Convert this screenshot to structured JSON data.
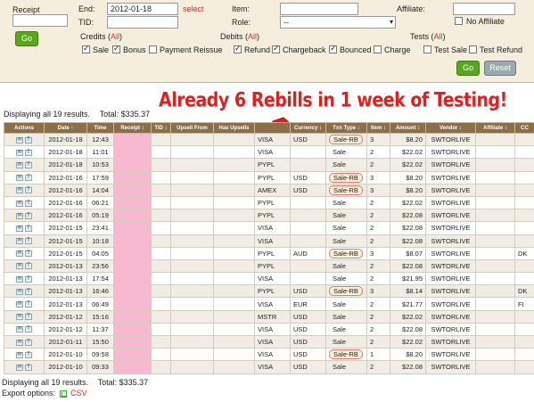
{
  "filter": {
    "receipt_label": "Receipt",
    "end_label": "End:",
    "end_value": "2012-01-18",
    "select_link": "select",
    "tid_label": "TID:",
    "item_label": "Item:",
    "role_label": "Role:",
    "role_value": "--",
    "affiliate_label": "Affiliate:",
    "no_affiliate_label": "No Affiliate",
    "go_label": "Go",
    "reset_label": "Reset",
    "credits_label": "Credits",
    "debits_label": "Debits",
    "tests_label": "Tests",
    "all_link": "All",
    "credits": [
      {
        "label": "Sale",
        "checked": true
      },
      {
        "label": "Bonus",
        "checked": true
      },
      {
        "label": "Payment Reissue",
        "checked": false
      }
    ],
    "debits": [
      {
        "label": "Refund",
        "checked": true
      },
      {
        "label": "Chargeback",
        "checked": true
      },
      {
        "label": "Bounced",
        "checked": true
      },
      {
        "label": "Charge",
        "checked": false
      }
    ],
    "tests": [
      {
        "label": "Test Sale",
        "checked": false
      },
      {
        "label": "Test Refund",
        "checked": false
      }
    ]
  },
  "annotation": "Already 6 Rebills in 1 week of Testing!",
  "summary": {
    "displaying": "Displaying all 19 results.",
    "total": "Total: $335.37"
  },
  "export": {
    "label": "Export options:",
    "csv": "CSV"
  },
  "table": {
    "columns": [
      "Actions",
      "Date ↑",
      "Time",
      "Receipt ↕",
      "TID ↕",
      "Upsell From",
      "Has Upsells",
      "",
      "Currency ↕",
      "Txn Type ↕",
      "Item ↕",
      "Amount ↕",
      "Vendor ↕",
      "Affiliate ↕",
      "CC"
    ],
    "rows": [
      {
        "date": "2012-01-18",
        "time": "12:43",
        "method": "VISA",
        "currency": "USD",
        "type": "Sale-RB",
        "item": "3",
        "amount": "$8.20",
        "vendor": "SWTORLIVE",
        "affiliate": "",
        "cc": "",
        "hl": true
      },
      {
        "date": "2012-01-18",
        "time": "11:01",
        "method": "VISA",
        "currency": "",
        "type": "Sale",
        "item": "2",
        "amount": "$22.02",
        "vendor": "SWTORLIVE",
        "affiliate": "",
        "cc": "",
        "hl": false
      },
      {
        "date": "2012-01-18",
        "time": "10:53",
        "method": "PYPL",
        "currency": "",
        "type": "Sale",
        "item": "2",
        "amount": "$22.02",
        "vendor": "SWTORLIVE",
        "affiliate": "",
        "cc": "",
        "hl": false
      },
      {
        "date": "2012-01-16",
        "time": "17:59",
        "method": "PYPL",
        "currency": "USD",
        "type": "Sale-RB",
        "item": "3",
        "amount": "$8.20",
        "vendor": "SWTORLIVE",
        "affiliate": "",
        "cc": "",
        "hl": false
      },
      {
        "date": "2012-01-16",
        "time": "14:04",
        "method": "AMEX",
        "currency": "USD",
        "type": "Sale-RB",
        "item": "3",
        "amount": "$8.20",
        "vendor": "SWTORLIVE",
        "affiliate": "",
        "cc": "",
        "hl": true
      },
      {
        "date": "2012-01-16",
        "time": "06:21",
        "method": "PYPL",
        "currency": "",
        "type": "Sale",
        "item": "2",
        "amount": "$22.02",
        "vendor": "SWTORLIVE",
        "affiliate": "",
        "cc": "",
        "hl": false
      },
      {
        "date": "2012-01-16",
        "time": "05:19",
        "method": "PYPL",
        "currency": "",
        "type": "Sale",
        "item": "2",
        "amount": "$22.08",
        "vendor": "SWTORLIVE",
        "affiliate": "",
        "cc": "",
        "hl": false
      },
      {
        "date": "2012-01-15",
        "time": "23:41",
        "method": "VISA",
        "currency": "",
        "type": "Sale",
        "item": "2",
        "amount": "$22.08",
        "vendor": "SWTORLIVE",
        "affiliate": "",
        "cc": "",
        "hl": false
      },
      {
        "date": "2012-01-15",
        "time": "10:18",
        "method": "VISA",
        "currency": "",
        "type": "Sale",
        "item": "2",
        "amount": "$22.08",
        "vendor": "SWTORLIVE",
        "affiliate": "",
        "cc": "",
        "hl": false
      },
      {
        "date": "2012-01-15",
        "time": "04:05",
        "method": "PYPL",
        "currency": "AUD",
        "type": "Sale-RB",
        "item": "3",
        "amount": "$8.07",
        "vendor": "SWTORLIVE",
        "affiliate": "",
        "cc": "DK",
        "hl": true
      },
      {
        "date": "2012-01-13",
        "time": "23:56",
        "method": "PYPL",
        "currency": "",
        "type": "Sale",
        "item": "2",
        "amount": "$22.08",
        "vendor": "SWTORLIVE",
        "affiliate": "",
        "cc": "",
        "hl": false
      },
      {
        "date": "2012-01-13",
        "time": "17:54",
        "method": "VISA",
        "currency": "",
        "type": "Sale",
        "item": "2",
        "amount": "$21.95",
        "vendor": "SWTORLIVE",
        "affiliate": "",
        "cc": "",
        "hl": false
      },
      {
        "date": "2012-01-13",
        "time": "16:46",
        "method": "PYPL",
        "currency": "USD",
        "type": "Sale-RB",
        "item": "3",
        "amount": "$8.14",
        "vendor": "SWTORLIVE",
        "affiliate": "",
        "cc": "DK",
        "hl": true
      },
      {
        "date": "2012-01-13",
        "time": "06:49",
        "method": "VISA",
        "currency": "EUR",
        "type": "Sale",
        "item": "2",
        "amount": "$21.77",
        "vendor": "SWTORLIVE",
        "affiliate": "",
        "cc": "FI",
        "hl": false
      },
      {
        "date": "2012-01-12",
        "time": "15:16",
        "method": "MSTR",
        "currency": "USD",
        "type": "Sale",
        "item": "2",
        "amount": "$22.02",
        "vendor": "SWTORLIVE",
        "affiliate": "",
        "cc": "",
        "hl": false
      },
      {
        "date": "2012-01-12",
        "time": "11:37",
        "method": "VISA",
        "currency": "USD",
        "type": "Sale",
        "item": "2",
        "amount": "$22.08",
        "vendor": "SWTORLIVE",
        "affiliate": "",
        "cc": "",
        "hl": false
      },
      {
        "date": "2012-01-11",
        "time": "15:50",
        "method": "VISA",
        "currency": "USD",
        "type": "Sale",
        "item": "2",
        "amount": "$22.02",
        "vendor": "SWTORLIVE",
        "affiliate": "",
        "cc": "",
        "hl": false
      },
      {
        "date": "2012-01-10",
        "time": "09:58",
        "method": "VISA",
        "currency": "USD",
        "type": "Sale-RB",
        "item": "1",
        "amount": "$8.20",
        "vendor": "SWTORLIVE",
        "affiliate": "",
        "cc": "",
        "hl": true
      },
      {
        "date": "2012-01-10",
        "time": "09:33",
        "method": "VISA",
        "currency": "USD",
        "type": "Sale",
        "item": "2",
        "amount": "$22.08",
        "vendor": "SWTORLIVE",
        "affiliate": "",
        "cc": "",
        "hl": false
      }
    ]
  },
  "colors": {
    "header_bg": "#8a6f4a",
    "annotation": "#e0201c",
    "go_button": "#5aa61e",
    "redacted": "#f6b9cf"
  }
}
